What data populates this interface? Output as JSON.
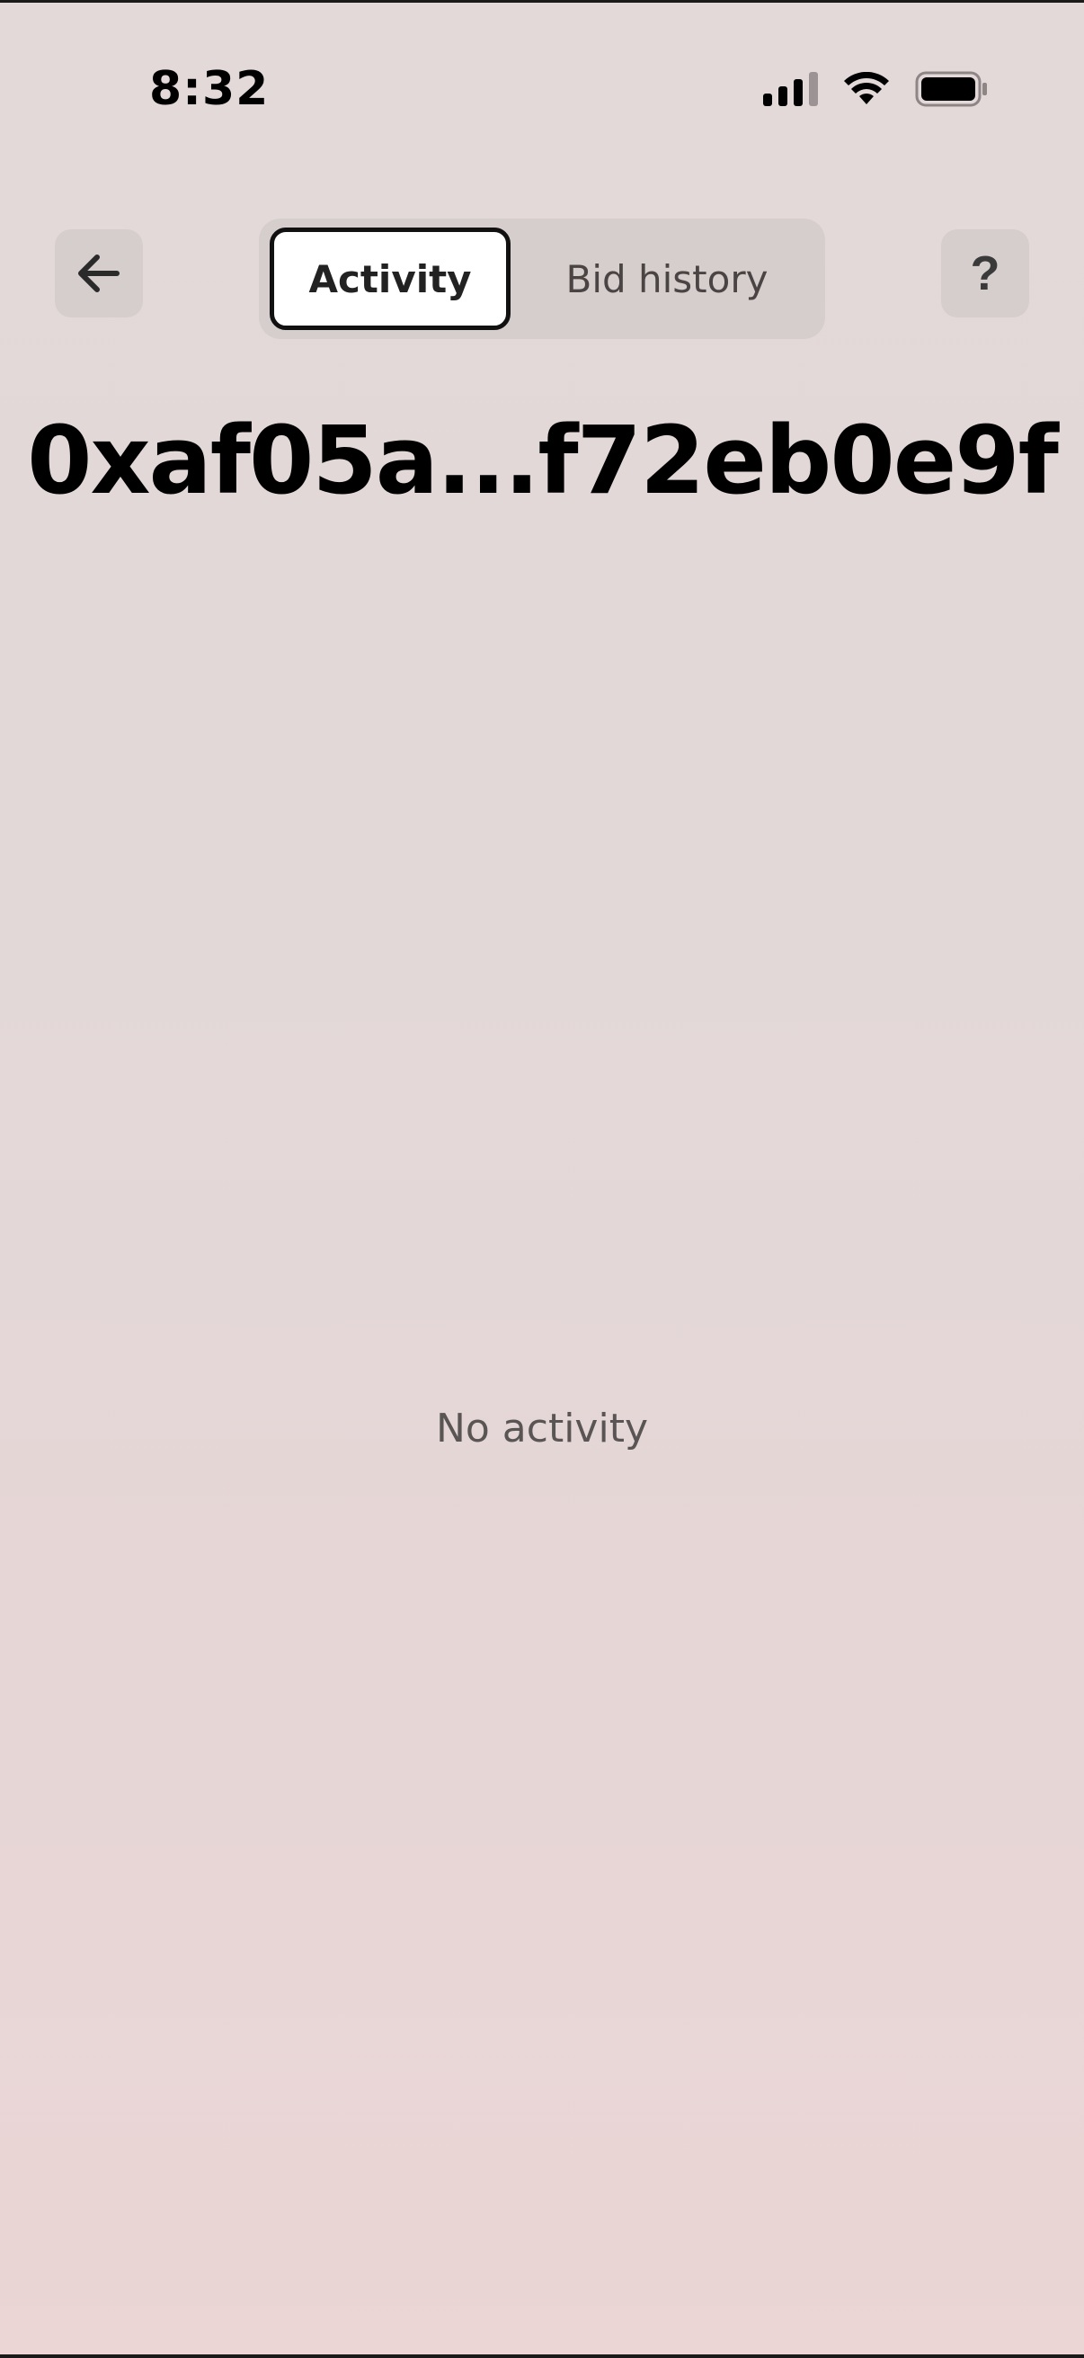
{
  "status_bar": {
    "time": "8:32",
    "icons": [
      "signal-icon",
      "wifi-icon",
      "battery-icon"
    ]
  },
  "header": {
    "back_icon": "arrow-left-icon",
    "help_label": "?",
    "tabs": [
      {
        "label": "Activity",
        "selected": true
      },
      {
        "label": "Bid history",
        "selected": false
      }
    ]
  },
  "main": {
    "title": "0xaf05a...f72eb0e9f",
    "empty_message": "No activity"
  },
  "colors": {
    "background_top": "#e2d9d8",
    "background_bottom": "#ebd5d5",
    "button_bg": "#d6cecd",
    "active_tab_bg": "#ffffff",
    "text_primary": "#000000",
    "text_muted": "#5a5555"
  }
}
